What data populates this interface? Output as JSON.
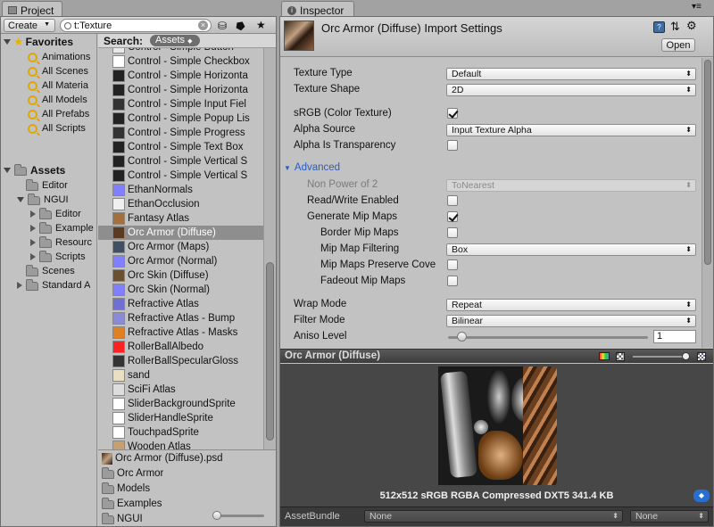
{
  "project": {
    "tab": "Project",
    "create_label": "Create",
    "search_value": "t:Texture",
    "favorites": {
      "label": "Favorites",
      "items": [
        "Animations",
        "All Scenes",
        "All Materia",
        "All Models",
        "All Prefabs",
        "All Scripts"
      ]
    },
    "assets": {
      "label": "Assets",
      "items": [
        {
          "label": "Editor",
          "indent": 1,
          "arrow": false
        },
        {
          "label": "NGUI",
          "indent": 1,
          "arrow": true,
          "open": true
        },
        {
          "label": "Editor",
          "indent": 2,
          "arrow": true
        },
        {
          "label": "Example",
          "indent": 2,
          "arrow": true
        },
        {
          "label": "Resourc",
          "indent": 2,
          "arrow": true
        },
        {
          "label": "Scripts",
          "indent": 2,
          "arrow": true
        },
        {
          "label": "Scenes",
          "indent": 1,
          "arrow": false
        },
        {
          "label": "Standard A",
          "indent": 1,
          "arrow": true
        }
      ]
    },
    "search_label": "Search:",
    "search_scope": "Assets",
    "results": [
      {
        "label": "Control - Simple Button",
        "thumb": "#e8e8e8"
      },
      {
        "label": "Control - Simple Checkbox",
        "thumb": "#ffffff"
      },
      {
        "label": "Control - Simple Horizonta",
        "thumb": "#222222"
      },
      {
        "label": "Control - Simple Horizonta",
        "thumb": "#222222"
      },
      {
        "label": "Control - Simple Input Fiel",
        "thumb": "#333333"
      },
      {
        "label": "Control - Simple Popup Lis",
        "thumb": "#222222"
      },
      {
        "label": "Control - Simple Progress",
        "thumb": "#333333"
      },
      {
        "label": "Control - Simple Text Box",
        "thumb": "#222222"
      },
      {
        "label": "Control - Simple Vertical S",
        "thumb": "#222222"
      },
      {
        "label": "Control - Simple Vertical S",
        "thumb": "#222222"
      },
      {
        "label": "EthanNormals",
        "thumb": "#8080ff"
      },
      {
        "label": "EthanOcclusion",
        "thumb": "#f0f0f0"
      },
      {
        "label": "Fantasy Atlas",
        "thumb": "#a07040"
      },
      {
        "label": "Orc Armor (Diffuse)",
        "thumb": "#5a3a20",
        "selected": true
      },
      {
        "label": "Orc Armor (Maps)",
        "thumb": "#405060"
      },
      {
        "label": "Orc Armor (Normal)",
        "thumb": "#8080ff"
      },
      {
        "label": "Orc Skin (Diffuse)",
        "thumb": "#6a5030"
      },
      {
        "label": "Orc Skin (Normal)",
        "thumb": "#8080ff"
      },
      {
        "label": "Refractive Atlas",
        "thumb": "#7070d0"
      },
      {
        "label": "Refractive Atlas - Bump",
        "thumb": "#8a8ad8"
      },
      {
        "label": "Refractive Atlas - Masks",
        "thumb": "#e08020"
      },
      {
        "label": "RollerBallAlbedo",
        "thumb": "#ff2020"
      },
      {
        "label": "RollerBallSpecularGloss",
        "thumb": "#333333"
      },
      {
        "label": "sand",
        "thumb": "#e8e0c0"
      },
      {
        "label": "SciFi Atlas",
        "thumb": "#dddddd"
      },
      {
        "label": "SliderBackgroundSprite",
        "thumb": "#ffffff"
      },
      {
        "label": "SliderHandleSprite",
        "thumb": "#ffffff"
      },
      {
        "label": "TouchpadSprite",
        "thumb": "#ffffff"
      },
      {
        "label": "Wooden Atlas",
        "thumb": "#c8a070"
      }
    ],
    "path_items": [
      {
        "label": "Orc Armor (Diffuse).psd",
        "icon": "texture"
      },
      {
        "label": "Orc Armor",
        "icon": "folder"
      },
      {
        "label": "Models",
        "icon": "folder"
      },
      {
        "label": "Examples",
        "icon": "folder"
      },
      {
        "label": "NGUI",
        "icon": "folder"
      }
    ]
  },
  "inspector": {
    "tab": "Inspector",
    "title": "Orc Armor (Diffuse) Import Settings",
    "open_label": "Open",
    "texture_type_label": "Texture Type",
    "texture_type_value": "Default",
    "texture_shape_label": "Texture Shape",
    "texture_shape_value": "2D",
    "srgb_label": "sRGB (Color Texture)",
    "srgb_checked": true,
    "alpha_source_label": "Alpha Source",
    "alpha_source_value": "Input Texture Alpha",
    "alpha_transparency_label": "Alpha Is Transparency",
    "alpha_transparency_checked": false,
    "advanced_label": "Advanced",
    "npot_label": "Non Power of 2",
    "npot_value": "ToNearest",
    "readwrite_label": "Read/Write Enabled",
    "readwrite_checked": false,
    "genmip_label": "Generate Mip Maps",
    "genmip_checked": true,
    "bordermip_label": "Border Mip Maps",
    "bordermip_checked": false,
    "mipfilter_label": "Mip Map Filtering",
    "mipfilter_value": "Box",
    "preservecov_label": "Mip Maps Preserve Cove",
    "preservecov_checked": false,
    "fadeout_label": "Fadeout Mip Maps",
    "fadeout_checked": false,
    "wrap_label": "Wrap Mode",
    "wrap_value": "Repeat",
    "filter_label": "Filter Mode",
    "filter_value": "Bilinear",
    "aniso_label": "Aniso Level",
    "aniso_value": "1"
  },
  "preview": {
    "title": "Orc Armor (Diffuse)",
    "info": "512x512 sRGB  RGBA Compressed DXT5   341.4 KB"
  },
  "assetbundle": {
    "label": "AssetBundle",
    "name_value": "None",
    "variant_value": "None"
  }
}
